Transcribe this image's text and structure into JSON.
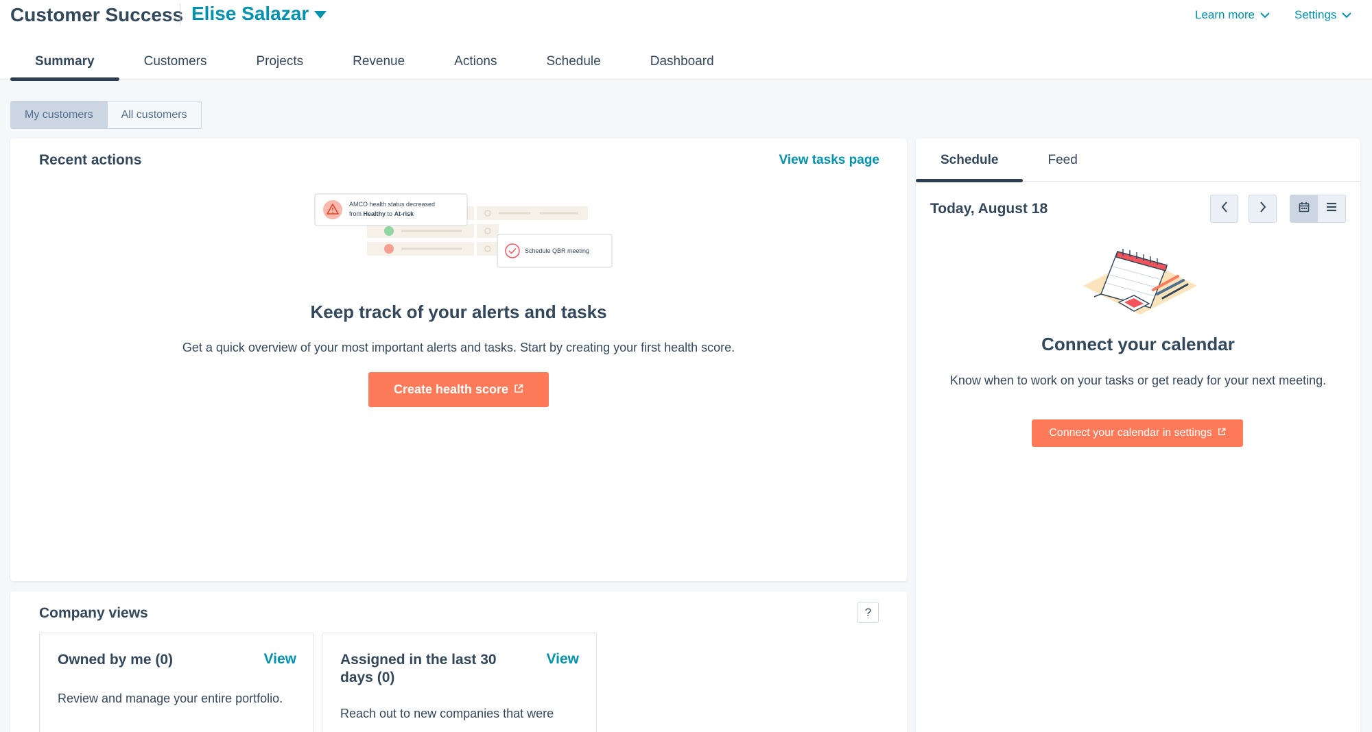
{
  "header": {
    "app_title": "Customer Success",
    "user_name": "Elise Salazar",
    "learn_more": "Learn more",
    "settings": "Settings"
  },
  "tabs": [
    {
      "label": "Summary",
      "active": true
    },
    {
      "label": "Customers"
    },
    {
      "label": "Projects"
    },
    {
      "label": "Revenue"
    },
    {
      "label": "Actions"
    },
    {
      "label": "Schedule"
    },
    {
      "label": "Dashboard"
    }
  ],
  "scope_toggle": {
    "options": [
      "My customers",
      "All customers"
    ],
    "selected": "My customers"
  },
  "recent_actions": {
    "title": "Recent actions",
    "link": "View tasks page",
    "illustration": {
      "alert_line1": "AMCO health status decreased",
      "alert_from": "from",
      "alert_healthy": "Healthy",
      "alert_to": "to",
      "alert_atrisk": "At-risk",
      "task_label": "Schedule QBR meeting"
    },
    "empty_title": "Keep track of your alerts and tasks",
    "empty_text": "Get a quick overview of your most important alerts and tasks. Start by creating your first health score.",
    "button": "Create health score"
  },
  "company_views": {
    "title": "Company views",
    "help": "?",
    "cards": [
      {
        "title": "Owned by me (0)",
        "link": "View",
        "description": "Review and manage your entire portfolio."
      },
      {
        "title": "Assigned in the last 30 days (0)",
        "link": "View",
        "description": "Reach out to new companies that were"
      }
    ]
  },
  "schedule_panel": {
    "tabs": [
      {
        "label": "Schedule",
        "active": true
      },
      {
        "label": "Feed"
      }
    ],
    "date": "Today, August 18",
    "empty_title": "Connect your calendar",
    "empty_text": "Know when to work on your tasks or get ready for your next meeting.",
    "button": "Connect your calendar in settings"
  },
  "icons": {
    "user_switch": "caret-down-icon",
    "learn_more": "chevron-down-icon",
    "settings": "chevron-down-icon",
    "external_link": "external-link-icon",
    "prev": "chevron-left-icon",
    "next": "chevron-right-icon",
    "calendar_view": "calendar-icon",
    "list_view": "list-icon",
    "alert": "warning-triangle-icon",
    "task_done": "check-circle-icon"
  },
  "colors": {
    "accent_link": "#0091ae",
    "primary_button": "#ff7a59",
    "text": "#33475b",
    "tab_indicator": "#2d3e50"
  }
}
